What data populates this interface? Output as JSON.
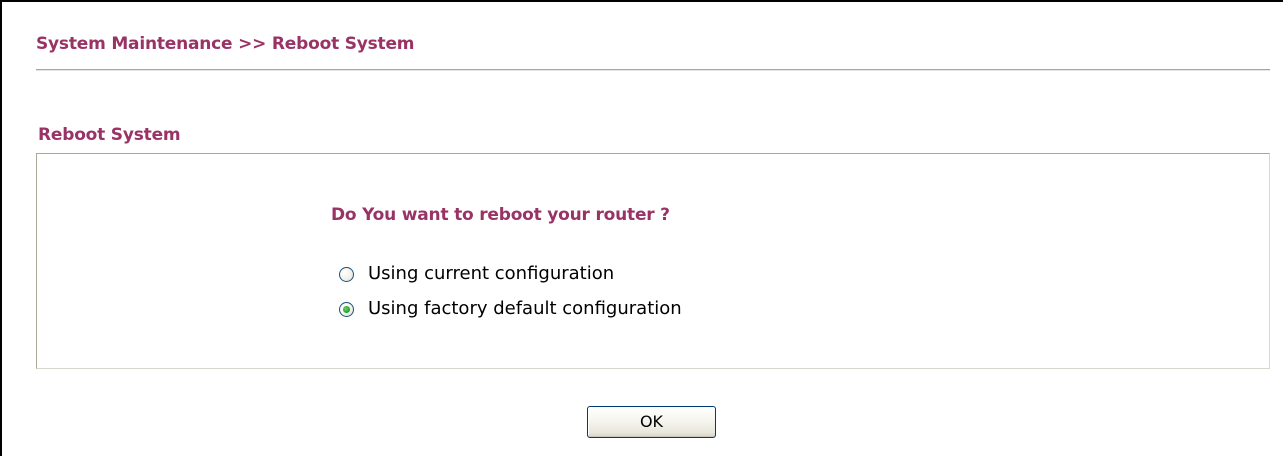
{
  "header": {
    "breadcrumb": "System Maintenance >> Reboot System"
  },
  "section": {
    "title": "Reboot System",
    "question": "Do You want to reboot your router ?",
    "options": [
      {
        "label": "Using current configuration",
        "checked": false
      },
      {
        "label": "Using factory default configuration",
        "checked": true
      }
    ]
  },
  "actions": {
    "ok_label": "OK"
  },
  "colors": {
    "heading": "#993366",
    "radio_checked": "#29a330",
    "button_border": "#003c74"
  }
}
